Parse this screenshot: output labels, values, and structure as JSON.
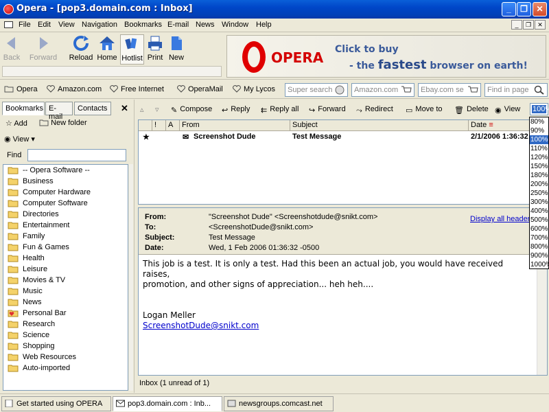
{
  "window": {
    "title": "Opera - [pop3.domain.com : Inbox]"
  },
  "menu": [
    "File",
    "Edit",
    "View",
    "Navigation",
    "Bookmarks",
    "E-mail",
    "News",
    "Window",
    "Help"
  ],
  "toolbar": {
    "back": "Back",
    "forward": "Forward",
    "reload": "Reload",
    "home": "Home",
    "hotlist": "Hotlist",
    "print": "Print",
    "new": "New"
  },
  "banner": {
    "brand": "OPERA",
    "line1": "Click to buy",
    "line2a": "- the ",
    "line2b": "fastest",
    "line2c": " browser on earth!"
  },
  "personalbar": {
    "items": [
      "Opera",
      "Amazon.com",
      "Free Internet",
      "OperaMail",
      "My Lycos"
    ],
    "search": [
      "Super search",
      "Amazon.com",
      "Ebay.com se",
      "Find in page"
    ]
  },
  "leftpanel": {
    "tabs": [
      "Bookmarks",
      "E-mail",
      "Contacts"
    ],
    "add": "Add",
    "new_folder": "New folder",
    "view": "View",
    "find": "Find",
    "bookmarks": [
      "-- Opera Software --",
      "Business",
      "Computer Hardware",
      "Computer Software",
      "Directories",
      "Entertainment",
      "Family",
      "Fun & Games",
      "Health",
      "Leisure",
      "Movies & TV",
      "Music",
      "News",
      "Personal Bar",
      "Research",
      "Science",
      "Shopping",
      "Web Resources",
      "Auto-imported"
    ]
  },
  "mailtoolbar": {
    "compose": "Compose",
    "reply": "Reply",
    "reply_all": "Reply all",
    "forward": "Forward",
    "redirect": "Redirect",
    "move_to": "Move to",
    "delete": "Delete",
    "view": "View",
    "zoom": "100%"
  },
  "msglist": {
    "headers": {
      "flag": "!",
      "att": "A",
      "from": "From",
      "subject": "Subject",
      "date": "Date"
    },
    "rows": [
      {
        "star": "★",
        "from": "Screenshot Dude",
        "subject": "Test Message",
        "date": "2/1/2006 1:36:32"
      }
    ]
  },
  "message": {
    "from_label": "From:",
    "to_label": "To:",
    "subject_label": "Subject:",
    "date_label": "Date:",
    "from": "\"Screenshot Dude\" <Screenshotdude@snikt.com>",
    "to": "<ScreenshotDude@snikt.com>",
    "subject": "Test Message",
    "date": "Wed, 1 Feb 2006 01:36:32 -0500",
    "display_all": "Display all headers",
    "body1": "This job is a test.  It is only a test.  Had this been an actual job, you would have received raises,",
    "body2": "promotion, and other signs of appreciation... heh heh....",
    "sig_name": "Logan Meller",
    "sig_email": "ScreenshotDude@snikt.com"
  },
  "status": "Inbox (1 unread of 1)",
  "pagetabs": [
    "Get started using OPERA",
    "pop3.domain.com : Inb...",
    "newsgroups.comcast.net"
  ],
  "zoom_options": [
    "80%",
    "90%",
    "100%",
    "110%",
    "120%",
    "150%",
    "180%",
    "200%",
    "250%",
    "300%",
    "400%",
    "500%",
    "600%",
    "700%",
    "800%",
    "900%",
    "1000%"
  ],
  "zoom_selected": "100%",
  "colors": {
    "title_blue": "#0046c8",
    "selection": "#316ac5",
    "link": "#0000cc",
    "opera_red": "#d40000"
  }
}
